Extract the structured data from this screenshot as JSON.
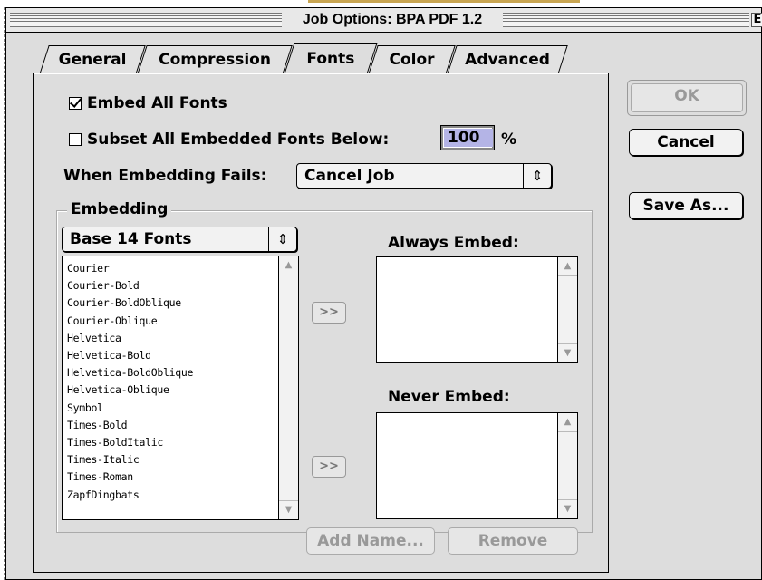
{
  "window": {
    "title": "Job Options: BPA PDF 1.2",
    "zoom_box_glyph": "E"
  },
  "tabs": [
    {
      "label": "General",
      "active": false
    },
    {
      "label": "Compression",
      "active": false
    },
    {
      "label": "Fonts",
      "active": true
    },
    {
      "label": "Color",
      "active": false
    },
    {
      "label": "Advanced",
      "active": false
    }
  ],
  "fonts": {
    "embed_all": {
      "label": "Embed All Fonts",
      "checked": true
    },
    "subset": {
      "label": "Subset All Embedded Fonts Below:",
      "checked": false,
      "value": "100",
      "unit": "%"
    },
    "when_fails": {
      "label": "When Embedding Fails:",
      "selected": "Cancel Job"
    },
    "embedding": {
      "group_title": "Embedding",
      "source_selected": "Base 14 Fonts",
      "font_list": [
        "Courier",
        "Courier-Bold",
        "Courier-BoldOblique",
        "Courier-Oblique",
        "Helvetica",
        "Helvetica-Bold",
        "Helvetica-BoldOblique",
        "Helvetica-Oblique",
        "Symbol",
        "Times-Bold",
        "Times-BoldItalic",
        "Times-Italic",
        "Times-Roman",
        "ZapfDingbats"
      ],
      "always_embed_label": "Always Embed:",
      "never_embed_label": "Never Embed:",
      "move_button_label": ">>",
      "add_name_label": "Add Name...",
      "remove_label": "Remove"
    }
  },
  "buttons": {
    "ok": "OK",
    "cancel": "Cancel",
    "save_as": "Save As..."
  },
  "icons": {
    "popup_arrows": "updown-arrows-icon",
    "scroll_up": "scroll-up-arrow-icon",
    "scroll_down": "scroll-down-arrow-icon"
  }
}
